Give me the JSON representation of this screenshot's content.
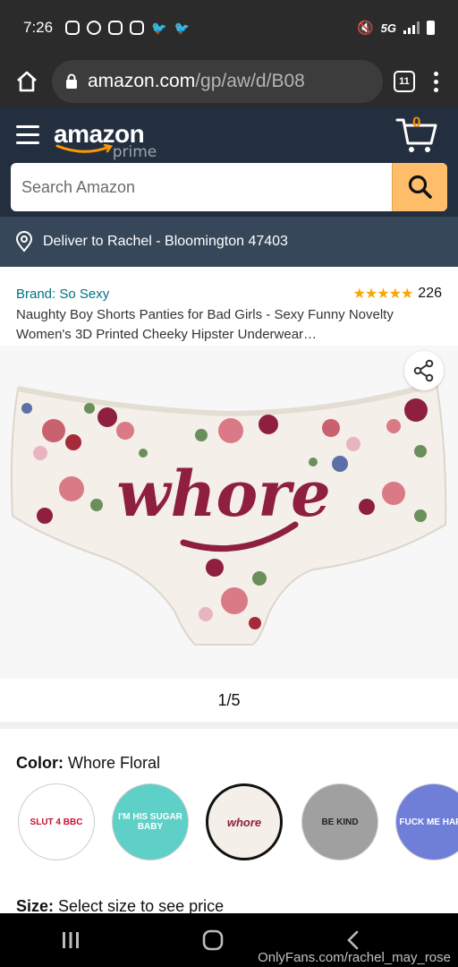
{
  "status_bar": {
    "time": "7:26",
    "network": "5G",
    "icons": [
      "instagram-icon",
      "messenger-icon",
      "instagram-icon",
      "instagram-icon",
      "twitter-icon",
      "twitter-icon",
      "mute-icon",
      "signal-icon",
      "battery-icon"
    ]
  },
  "browser": {
    "url_domain": "amazon.com",
    "url_path": "/gp/aw/d/B08",
    "tab_count": "11"
  },
  "header": {
    "logo_text": "amazon",
    "logo_sub": "prime",
    "cart_count": "0",
    "search_placeholder": "Search Amazon",
    "deliver_text": "Deliver to Rachel - Bloomington 47403"
  },
  "product": {
    "brand": "Brand: So Sexy",
    "rating_count": "226",
    "stars": "★★★★★",
    "title": "Naughty Boy Shorts Panties for Bad Girls - Sexy Funny Novelty Women's 3D Printed Cheeky Hipster Underwear…",
    "image_word": "whore",
    "pager": "1/5"
  },
  "color": {
    "label": "Color:",
    "value": "Whore Floral",
    "swatches": [
      {
        "label": "SLUT 4 BBC",
        "bg": "#ffffff"
      },
      {
        "label": "I'M HIS SUGAR BABY",
        "bg": "#5fd0c7"
      },
      {
        "label": "whore",
        "bg": "#f4efe8"
      },
      {
        "label": "BE KIND",
        "bg": "#a0a0a0"
      },
      {
        "label": "FUCK ME HARD",
        "bg": "#6f7fd8"
      }
    ]
  },
  "size": {
    "label": "Size:",
    "value": "Select size to see price"
  },
  "watermark": "OnlyFans.com/rachel_may_rose",
  "colors": {
    "amazon_dark": "#232f3e",
    "amazon_deliver": "#37475a",
    "search_button": "#febd69",
    "link": "#007185",
    "star": "#f7a700",
    "print_text": "#8e1f3f"
  }
}
